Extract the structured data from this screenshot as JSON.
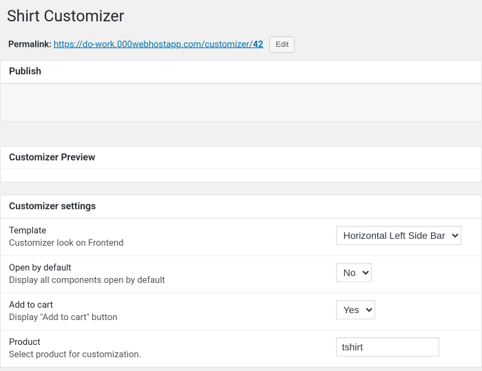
{
  "page": {
    "title": "Shirt Customizer"
  },
  "permalink": {
    "label": "Permalink:",
    "url_base": "https://do-work.000webhostapp.com/customizer/",
    "id": "42",
    "edit_label": "Edit"
  },
  "boxes": {
    "publish": {
      "title": "Publish"
    },
    "preview": {
      "title": "Customizer Preview"
    },
    "settings": {
      "title": "Customizer settings"
    }
  },
  "settings": {
    "template": {
      "label": "Template",
      "desc": "Customizer look on Frontend",
      "value": "Horizontal Left Side Bar"
    },
    "open_default": {
      "label": "Open by default",
      "desc": "Display all components open by default",
      "value": "No"
    },
    "add_to_cart": {
      "label": "Add to cart",
      "desc": "Display \"Add to cart\" button",
      "value": "Yes"
    },
    "product": {
      "label": "Product",
      "desc": "Select product for customization.",
      "value": "tshirt"
    }
  }
}
